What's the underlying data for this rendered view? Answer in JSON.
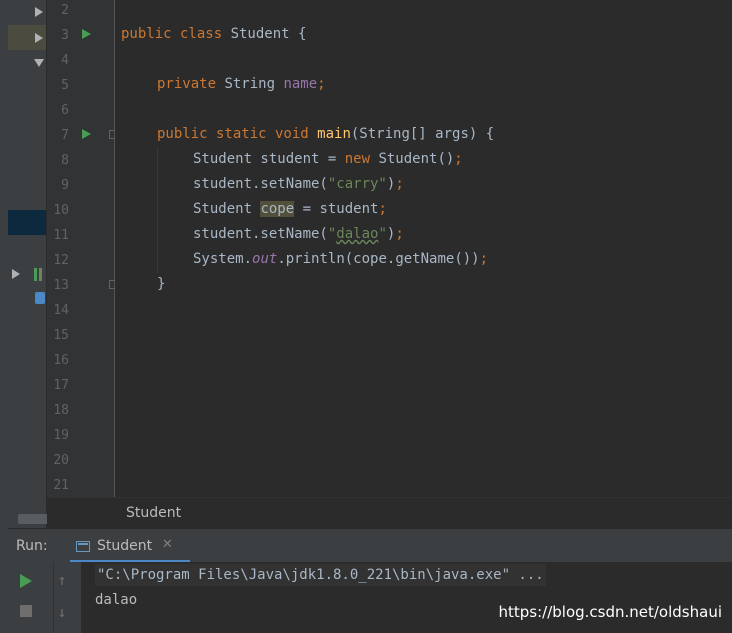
{
  "gutter": {
    "line_numbers": [
      "2",
      "3",
      "4",
      "5",
      "6",
      "7",
      "8",
      "9",
      "10",
      "11",
      "12",
      "13",
      "14",
      "15",
      "16",
      "17",
      "18",
      "19",
      "20",
      "21"
    ]
  },
  "code": {
    "line3": {
      "kw": "public class ",
      "rest": "Student {"
    },
    "line5": {
      "kw": "private ",
      "type": "String ",
      "field": "name",
      "semi": ";"
    },
    "line7": {
      "kw": "public static void ",
      "fn": "main",
      "rest": "(String[] args) {"
    },
    "line8": {
      "pre": "Student student = ",
      "kw": "new ",
      "rest": "Student()",
      "semi": ";"
    },
    "line9": {
      "pre": "student.setName(",
      "str": "\"carry\"",
      "post": ")",
      "semi": ";"
    },
    "line10": {
      "pre": "Student ",
      "hl": "cope",
      "post": " = student",
      "semi": ";"
    },
    "line11": {
      "pre": "student.setName(",
      "q1": "\"",
      "str": "dalao",
      "q2": "\"",
      "post": ")",
      "semi": ";"
    },
    "line12": {
      "pre": "System.",
      "it": "out",
      "post": ".println(cope.getName())",
      "semi": ";"
    },
    "line13": {
      "brace": "}"
    }
  },
  "breadcrumb": {
    "label": "Student"
  },
  "run": {
    "label": "Run:",
    "tab_label": "Student",
    "close_glyph": "✕",
    "up_glyph": "↑",
    "down_glyph": "↓",
    "console": {
      "command": "\"C:\\Program Files\\Java\\jdk1.8.0_221\\bin\\java.exe\" ...",
      "output": "dalao"
    }
  },
  "watermark": "https://blog.csdn.net/oldshaui",
  "colors": {
    "keyword": "#CC7832",
    "string": "#6A8759",
    "field": "#9876AA",
    "method": "#FFC66D",
    "run_green": "#499C54"
  }
}
